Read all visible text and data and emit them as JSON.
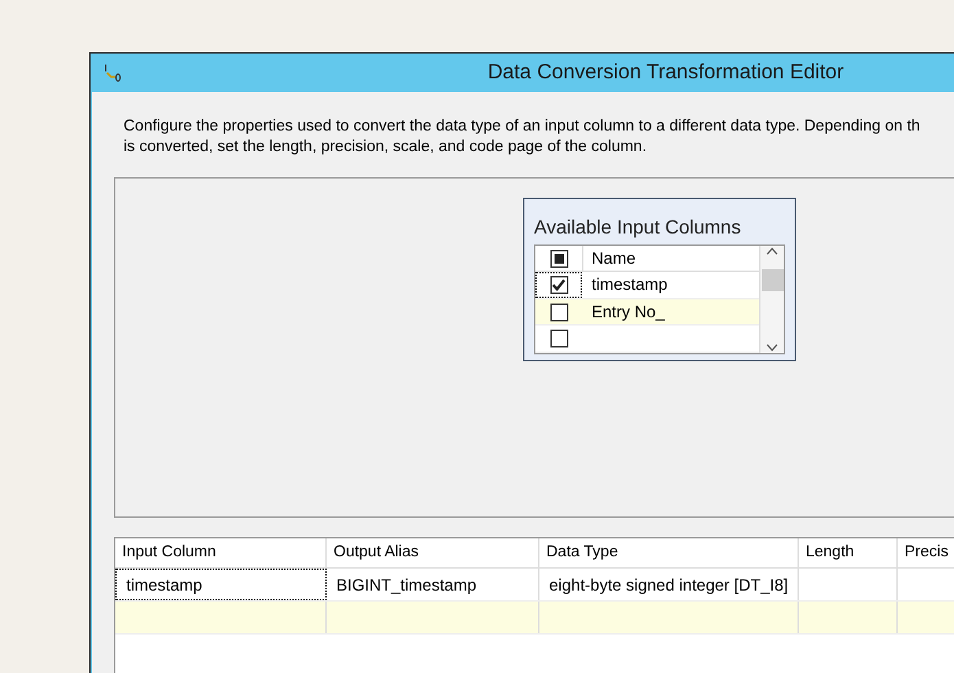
{
  "window": {
    "title": "Data Conversion Transformation Editor"
  },
  "description": [
    "Configure the properties used to convert the data type of an input column to a different data type. Depending on th",
    "is converted, set the length, precision, scale, and code page of the column."
  ],
  "available_columns": {
    "title": "Available Input Columns",
    "header": {
      "label": "Name",
      "partial": true
    },
    "rows": [
      {
        "name": "timestamp",
        "checked": true,
        "focused": true,
        "highlighted": false
      },
      {
        "name": "Entry No_",
        "checked": false,
        "focused": false,
        "highlighted": true
      },
      {
        "checked": false,
        "focused": false,
        "highlighted": false
      }
    ]
  },
  "table": {
    "columns": [
      "Input Column",
      "Output Alias",
      "Data Type",
      "Length",
      "Precis"
    ],
    "rows": [
      {
        "cells": [
          "timestamp",
          "BIGINT_timestamp",
          "eight-byte signed integer [DT_I8]"
        ],
        "highlighted": false
      },
      {
        "highlighted": true
      }
    ]
  }
}
